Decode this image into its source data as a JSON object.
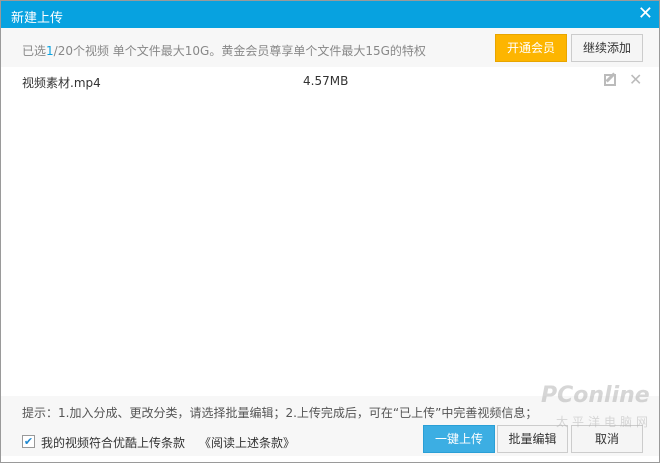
{
  "window": {
    "title": "新建上传"
  },
  "info": {
    "prefix": "已选",
    "selected": "1",
    "suffix": "/20个视频  单个文件最大10G。黄金会员尊享单个文件最大15G的特权",
    "vip_button": "开通会员",
    "add_button": "继续添加"
  },
  "files": [
    {
      "name": "视频素材.mp4",
      "size": "4.57MB"
    }
  ],
  "footer": {
    "tip": "提示：1.加入分成、更改分类，请选择批量编辑；2.上传完成后，可在“已上传”中完善视频信息；",
    "agree_checked": true,
    "agree_label": "我的视频符合优酷上传条款",
    "read_link": "《阅读上述条款》",
    "upload_button": "一键上传",
    "batch_button": "批量编辑",
    "cancel_button": "取消"
  },
  "watermark": {
    "logo": "PConline",
    "sub": "太平洋电脑网"
  }
}
